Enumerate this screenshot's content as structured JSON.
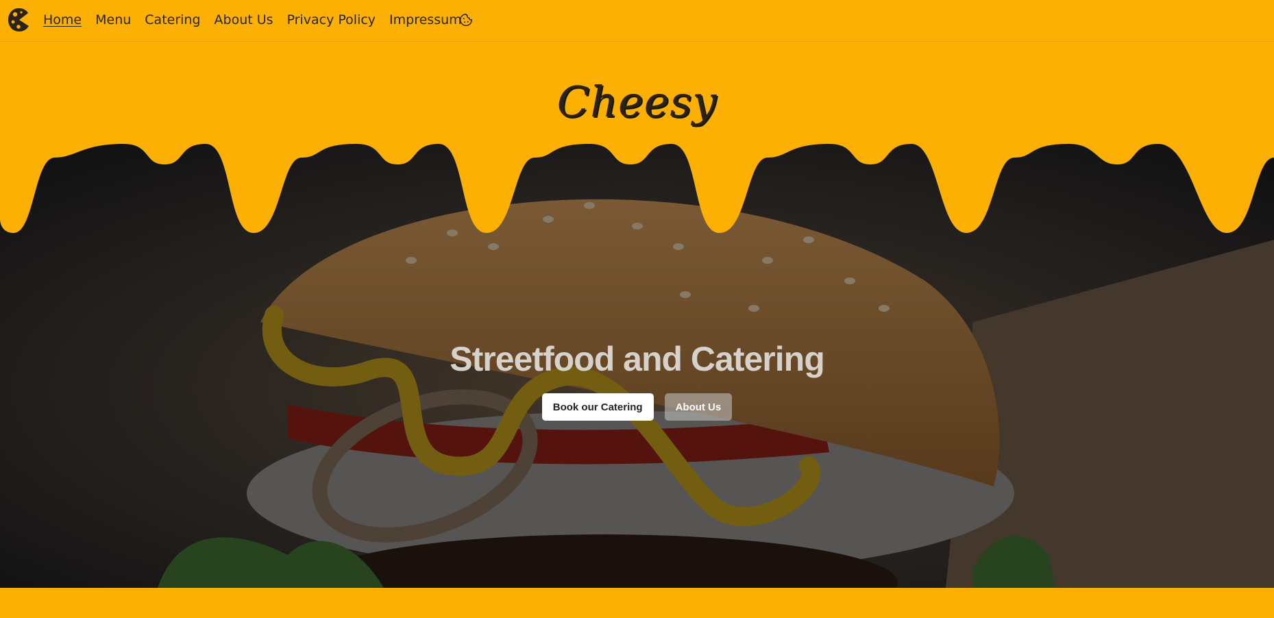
{
  "nav": {
    "items": [
      {
        "label": "Home"
      },
      {
        "label": "Menu"
      },
      {
        "label": "Catering"
      },
      {
        "label": "About Us"
      },
      {
        "label": "Privacy Policy"
      },
      {
        "label": "Impressum"
      }
    ],
    "logo_icon": "cheese-logo-icon",
    "cookie_icon": "cookie-icon"
  },
  "brand": {
    "name": "Cheesy"
  },
  "hero": {
    "title": "Streetfood and Catering",
    "primary_button": "Book our Catering",
    "secondary_button": "About Us",
    "image_icon": "burger-photo"
  },
  "colors": {
    "brand_yellow": "#fcb003",
    "dark_text": "#2a2418",
    "button_white": "#ffffff"
  }
}
